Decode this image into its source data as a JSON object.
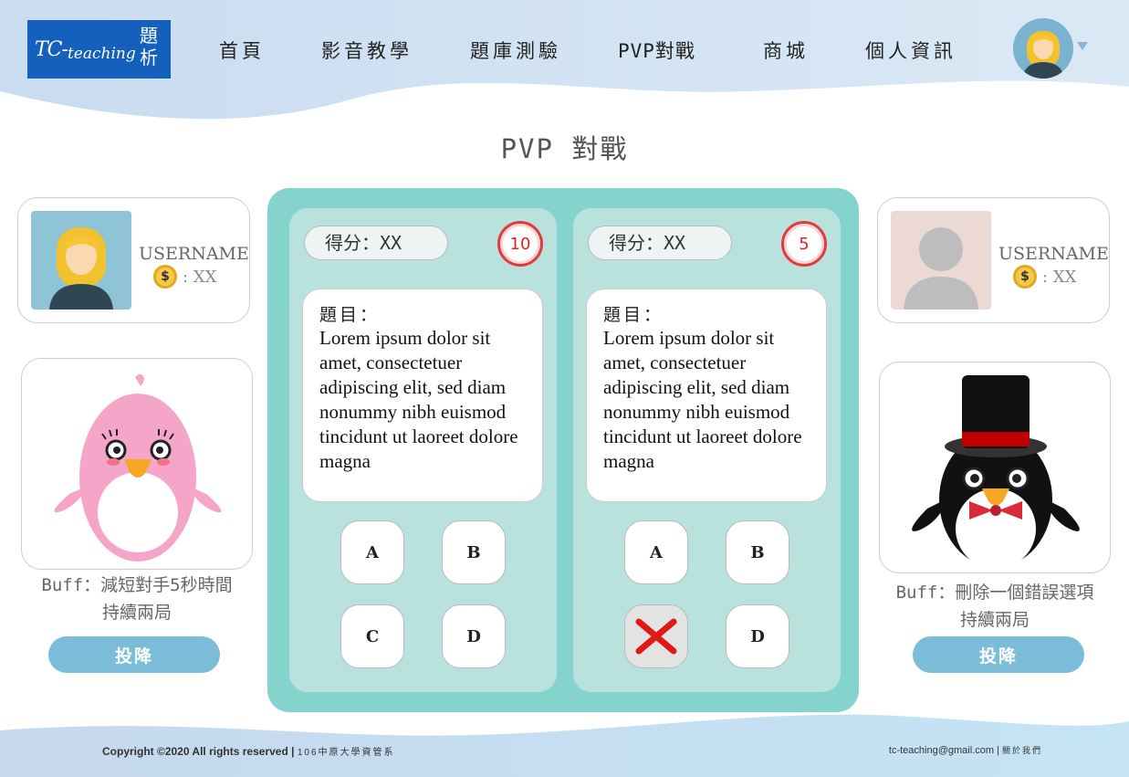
{
  "logo": {
    "brand": "TC-",
    "brand_sub": "teaching",
    "cn_top": "題",
    "cn_bottom": "析"
  },
  "nav": {
    "items": [
      "首頁",
      "影音教學",
      "題庫測驗",
      "PVP對戰",
      "商城",
      "個人資訊"
    ]
  },
  "page_title": "PVP 對戰",
  "player_left": {
    "username": "USERNAME",
    "coin_symbol": "$",
    "coins": ": XX",
    "buff_line1": "Buff：減短對手5秒時間",
    "buff_line2": "持續兩局",
    "surrender": "投降"
  },
  "player_right": {
    "username": "USERNAME",
    "coin_symbol": "$",
    "coins": ": XX",
    "buff_line1": "Buff：刪除一個錯誤選項",
    "buff_line2": "持續兩局",
    "surrender": "投降"
  },
  "panel_left": {
    "score": "得分：XX",
    "timer": "10",
    "question_label": "題目：",
    "question_text": "Lorem ipsum dolor sit amet, consectetuer adipiscing elit, sed diam nonummy nibh euismod tincidunt ut laoreet dolore magna",
    "options": [
      "A",
      "B",
      "C",
      "D"
    ]
  },
  "panel_right": {
    "score": "得分：XX",
    "timer": "5",
    "question_label": "題目：",
    "question_text": "Lorem ipsum dolor sit amet, consectetuer adipiscing elit, sed diam nonummy nibh euismod tincidunt ut laoreet dolore magna",
    "options": [
      "A",
      "B",
      "",
      "D"
    ],
    "removed_option_icon": "red-x-icon"
  },
  "footer": {
    "copyright": "Copyright ©2020 All rights reserved |",
    "org": "106中原大學資管系",
    "email": "tc-teaching@gmail.com |",
    "about": "關於我們"
  },
  "colors": {
    "logo_bg": "#1560bd",
    "arena_bg": "#84d3cd",
    "panel_bg": "#b9e2df",
    "surrender_bg": "#7bbcd9",
    "timer_red": "#e23b3b"
  }
}
